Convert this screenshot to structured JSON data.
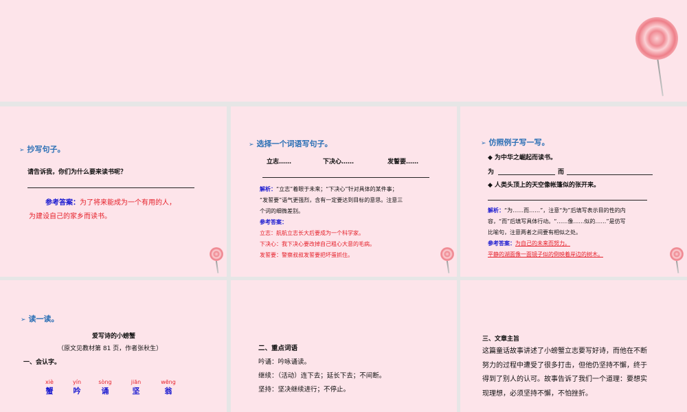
{
  "slide2": {
    "heading": "抄写句子。",
    "question": "请告诉我，你们为什么要来读书呢？",
    "answer_label": "参考答案：",
    "answer_line1": "为了将来能成为一个有用的人，",
    "answer_line2": "为建设自己的家乡而读书。"
  },
  "slide3": {
    "heading": "选择一个词语写句子。",
    "words": [
      "立志……",
      "下决心……",
      "发誓要……"
    ],
    "analysis_label": "解析：",
    "analysis_lines": [
      "“立志”着眼于未来；“下决心”针对具体的某件事；",
      "“发誓要”语气更强烈，含有一定要达到目标的意思。注意三",
      "个词的细微差别。"
    ],
    "answer_label": "参考答案：",
    "answers": [
      "立志：航航立志长大后要成为一个科学家。",
      "下决心：我下决心要改掉自己粗心大意的毛病。",
      "发誓要：警察叔叔发誓要把坏蛋抓住。"
    ]
  },
  "slide4": {
    "heading": "仿照例子写一写。",
    "example1": "◆ 为中华之崛起而读书。",
    "fill_wei": "为",
    "fill_er": "而",
    "example2": "◆ 人类头顶上的天空像帐篷似的张开来。",
    "analysis_label": "解析：",
    "analysis_lines": [
      "“为……而……”，注意“为”后填写表示目的性的内",
      "容，“而”后填写具体行动。“……像……似的……”是仿写",
      "比喻句，注意两者之间要有相似之处。"
    ],
    "answer_label": "参考答案：",
    "answers": [
      "为自己的未来而努力。",
      "平静的湖面像一面镜子似的倒映着岸边的树木。"
    ]
  },
  "slide5": {
    "heading": "读一读。",
    "title": "爱写诗的小螃蟹",
    "source": "（原文见教材第 81 页，作者张秋生）",
    "section": "一、会认字。",
    "chars": [
      {
        "pinyin": "xiè",
        "hanzi": "蟹"
      },
      {
        "pinyin": "yín",
        "hanzi": "吟"
      },
      {
        "pinyin": "sòng",
        "hanzi": "诵"
      },
      {
        "pinyin": "jiān",
        "hanzi": "坚"
      },
      {
        "pinyin": "wēng",
        "hanzi": "翁"
      }
    ]
  },
  "slide6": {
    "section": "二、重点词语",
    "items": [
      "吟诵：吟咏诵读。",
      "继续：（活动）连下去；延长下去；不间断。",
      "坚持：坚决继续进行；不停止。"
    ]
  },
  "slide7": {
    "section": "三、文章主旨",
    "lines": [
      "这篇童话故事讲述了小螃蟹立志要写好诗，而他在不断",
      "努力的过程中遭受了很多打击，但他仍坚持不懈，终于",
      "得到了别人的认可。故事告诉了我们一个道理：要想实",
      "现理想，必须坚持不懈，不怕挫折。"
    ]
  }
}
